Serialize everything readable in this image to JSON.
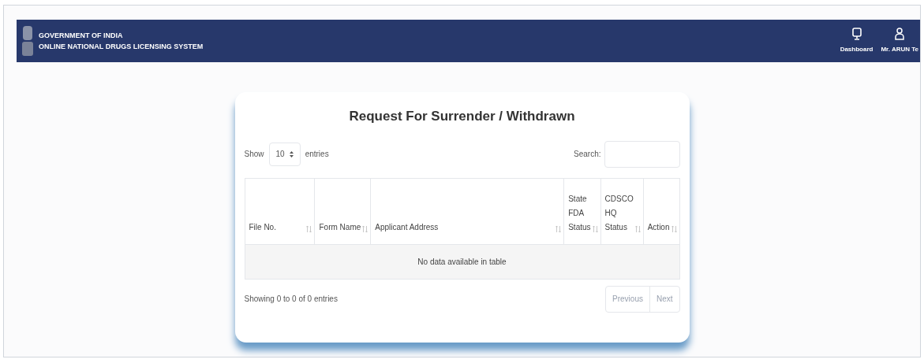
{
  "header": {
    "line_1": "GOVERNMENT OF INDIA",
    "line_2": "ONLINE NATIONAL DRUGS LICENSING SYSTEM",
    "nav": [
      {
        "label": "Dashboard",
        "kind": "monitor"
      },
      {
        "label": "Mr. ARUN Te",
        "kind": "user"
      }
    ]
  },
  "card": {
    "title": "Request For Surrender / Withdrawn",
    "length": {
      "before": "Show",
      "value": "10",
      "after": "entries"
    },
    "search": {
      "label": "Search:"
    },
    "table": {
      "columns": [
        {
          "label": "File No."
        },
        {
          "label": "Form Name"
        },
        {
          "label": "Applicant Address"
        },
        {
          "label": "State FDA Status"
        },
        {
          "label": "CDSCO HQ Status"
        },
        {
          "label": "Action"
        }
      ],
      "empty": "No data available in table"
    },
    "info": "Showing 0 to 0 of 0 entries",
    "pagination": [
      "Previous",
      "Next"
    ]
  }
}
